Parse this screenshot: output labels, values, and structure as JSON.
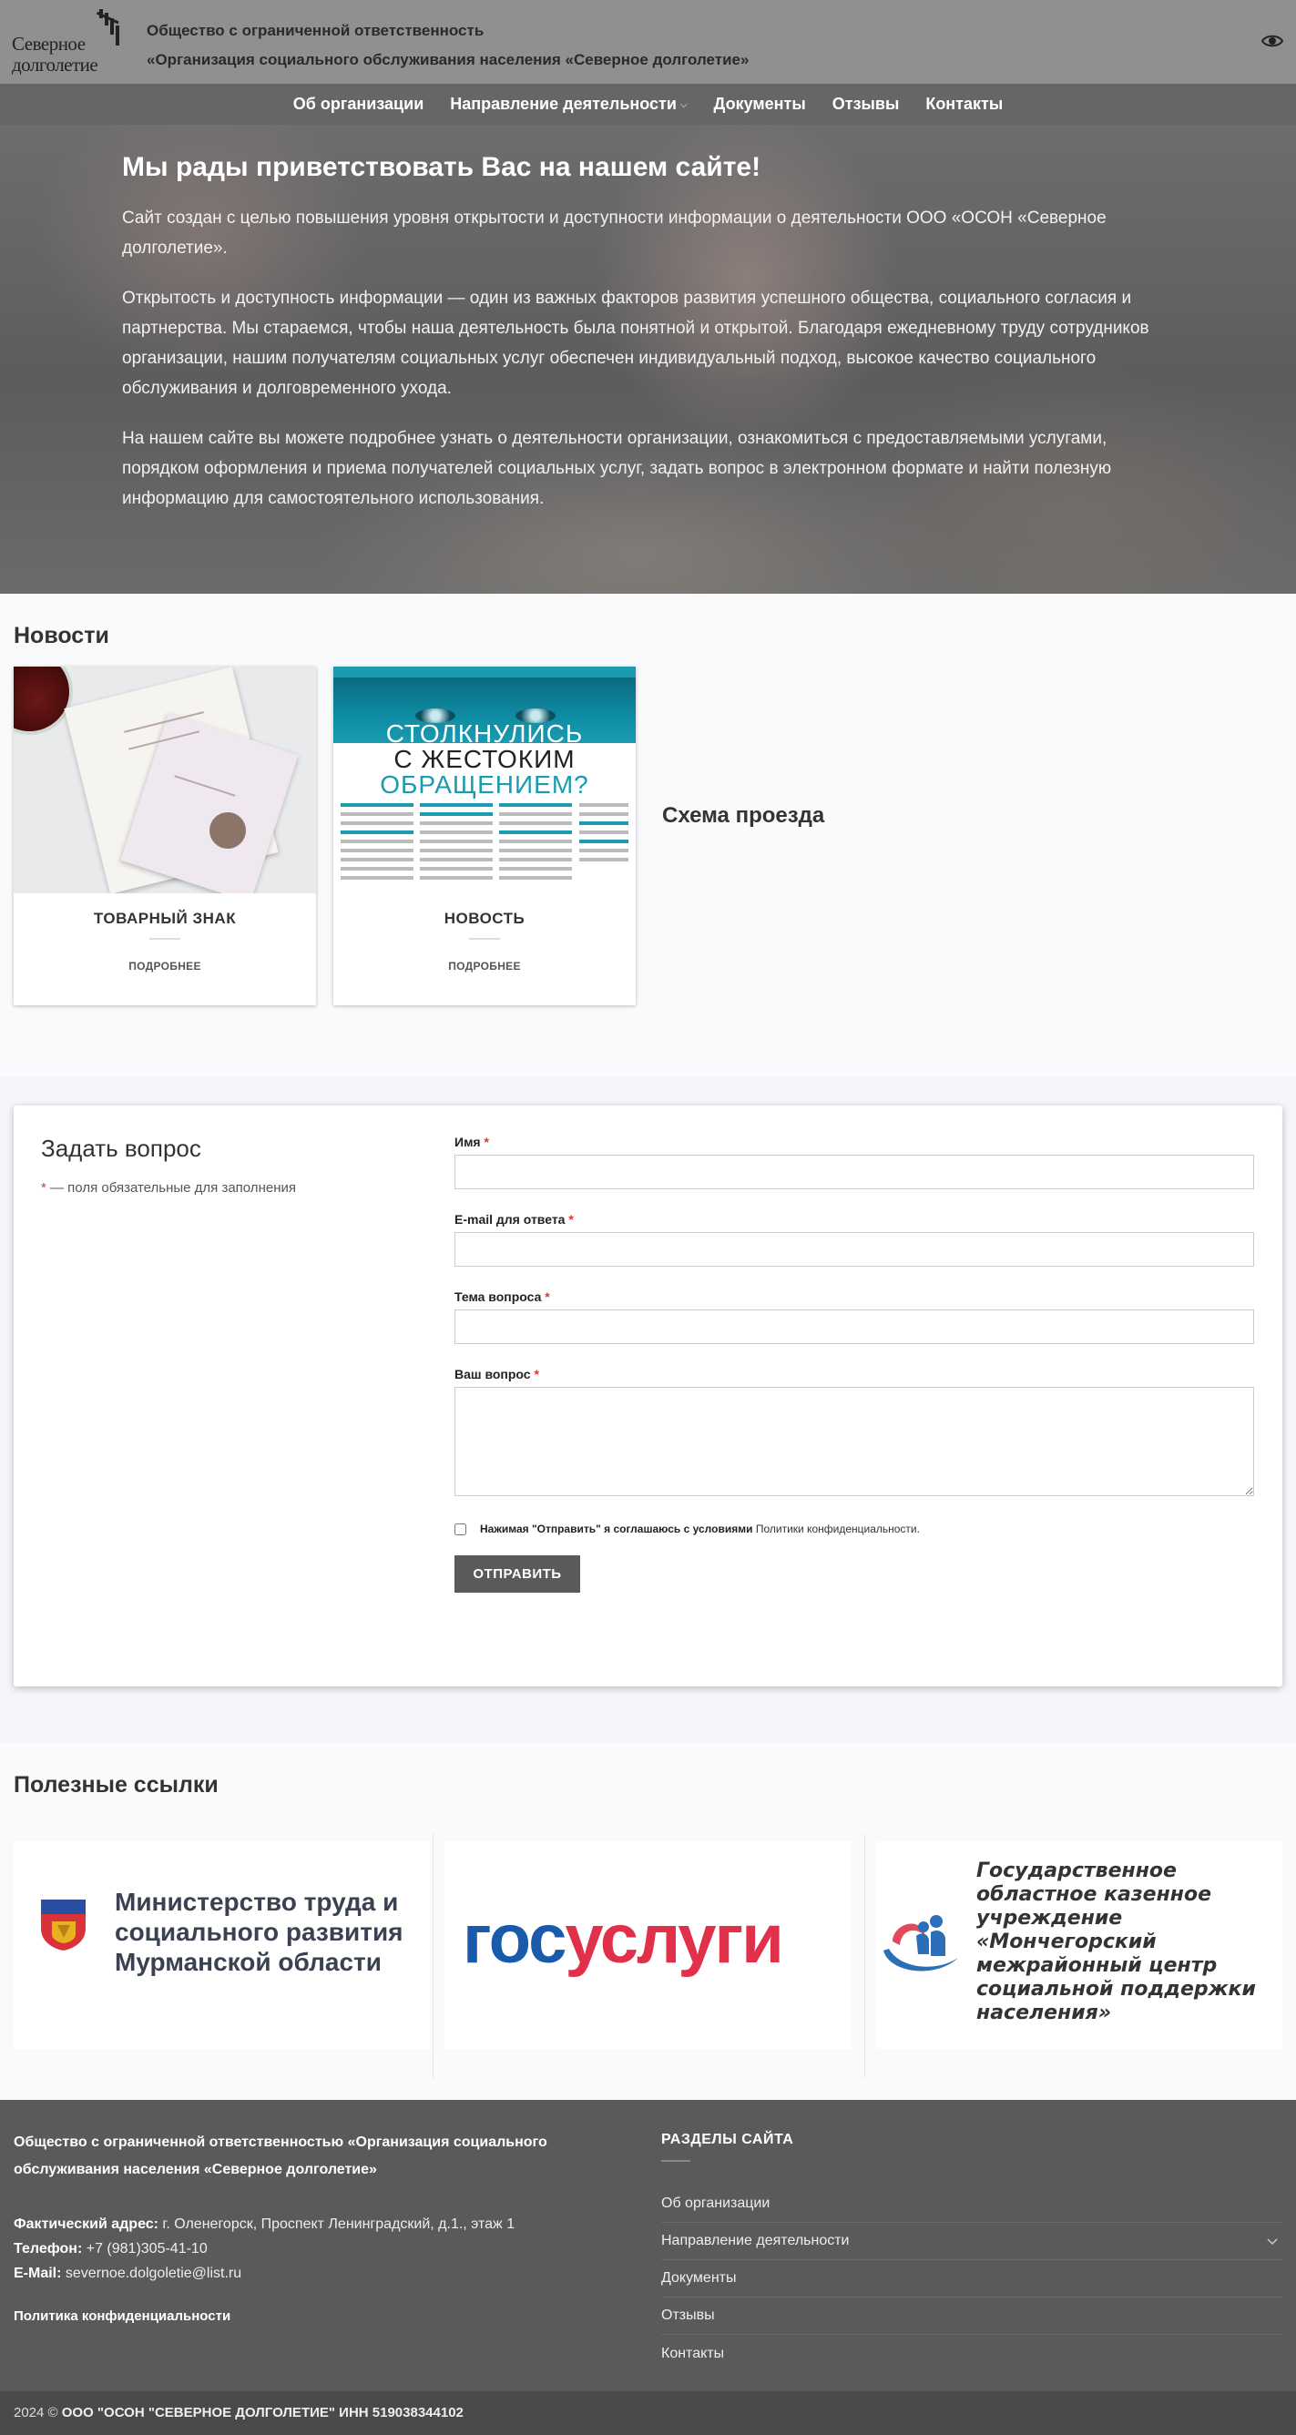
{
  "header": {
    "logo_line1": "Северное",
    "logo_line2": "долголетие",
    "org_line1": "Общество с ограниченной ответственность",
    "org_line2": "«Организация социального обслуживания населения «Северное долголетие»",
    "accessibility_icon": "eye-icon"
  },
  "nav": {
    "items": [
      {
        "label": "Об организации"
      },
      {
        "label": "Направление деятельности",
        "dropdown": true
      },
      {
        "label": "Документы"
      },
      {
        "label": "Отзывы"
      },
      {
        "label": "Контакты"
      }
    ]
  },
  "hero": {
    "title": "Мы рады приветствовать Вас на нашем сайте!",
    "paragraphs": [
      "Сайт создан с целью повышения уровня открытости и доступности информации о деятельности ООО «ОСОН «Северное долголетие».",
      "Открытость и доступность информации — один из важных факторов развития успешного общества, социального согласия и партнерства. Мы стараемся, чтобы наша деятельность была понятной и открытой. Благодаря ежедневному труду сотрудников организации, нашим получателям социальных услуг обеспечен индивидуальный подход, высокое качество социального обслуживания и долговременного ухода.",
      "На нашем сайте вы можете подробнее узнать о деятельности организации, ознакомиться с предоставляемыми услугами, порядком оформления и приема получателей социальных услуг, задать вопрос в электронном формате и найти полезную информацию для самостоятельного использования."
    ]
  },
  "news": {
    "title": "Новости",
    "cards": [
      {
        "title": "ТОВАРНЫЙ ЗНАК",
        "more": "ПОДРОБНЕЕ"
      },
      {
        "title": "НОВОСТЬ",
        "more": "ПОДРОБНЕЕ",
        "image_text": {
          "line1": "СТОЛКНУЛИСЬ",
          "line2": "С ЖЕСТОКИМ",
          "line3": "ОБРАЩЕНИЕМ?"
        }
      }
    ],
    "route_title": "Схема проезда"
  },
  "question_form": {
    "title": "Задать вопрос",
    "required_star": "*",
    "required_note": " — поля обязательные для заполнения",
    "fields": [
      {
        "label": "Имя",
        "value": ""
      },
      {
        "label": "E-mail для ответа",
        "value": ""
      },
      {
        "label": "Тема вопроса",
        "value": ""
      },
      {
        "label": "Ваш вопрос",
        "value": ""
      }
    ],
    "consent_text": "Нажимая \"Отправить\" я соглашаюсь с условиями ",
    "consent_link": "Политики конфиденциальности.",
    "submit_label": "ОТПРАВИТЬ"
  },
  "useful_links": {
    "title": "Полезные ссылки",
    "ministry_line1": "Министерство труда и",
    "ministry_line2": "социального развития",
    "ministry_line3": "Мурманской области",
    "gosuslugi_part1": "гос",
    "gosuslugi_part2": "услуги",
    "center_line1": "Государственное",
    "center_line2": "областное казенное",
    "center_line3": "учреждение",
    "center_line4": "«Мончегорский",
    "center_line5": "межрайонный центр",
    "center_line6": "социальной поддержки",
    "center_line7": "населения»"
  },
  "footer": {
    "org_full": "Общество с ограниченной ответственностью «Организация социального обслуживания населения «Северное долголетие»",
    "address_label": "Фактический адрес:",
    "address_value": " г. Оленегорск, Проспект Ленинградский, д.1., этаж 1",
    "phone_label": "Телефон:",
    "phone_value": " +7 (981)305-41-10",
    "email_label": "E-Mail:",
    "email_value": "severnoe.dolgoletie@list.ru",
    "policy_link": "Политика конфиденциальности",
    "sections_title": "РАЗДЕЛЫ САЙТА",
    "sections": [
      {
        "label": "Об организации"
      },
      {
        "label": "Направление деятельности",
        "expandable": true
      },
      {
        "label": "Документы"
      },
      {
        "label": "Отзывы"
      },
      {
        "label": "Контакты"
      }
    ],
    "copyright_year": "2024 © ",
    "copyright_text": "ООО \"ОСОН \"СЕВЕРНОЕ ДОЛГОЛЕТИЕ\" ИНН 519038344102"
  },
  "colors": {
    "header_bg": "#909090",
    "nav_bg": "#666666",
    "footer_bg": "#5a5a5a",
    "required_star": "#dd3333",
    "gosuslugi_blue": "#1a5aaa",
    "gosuslugi_red": "#e0304a"
  }
}
